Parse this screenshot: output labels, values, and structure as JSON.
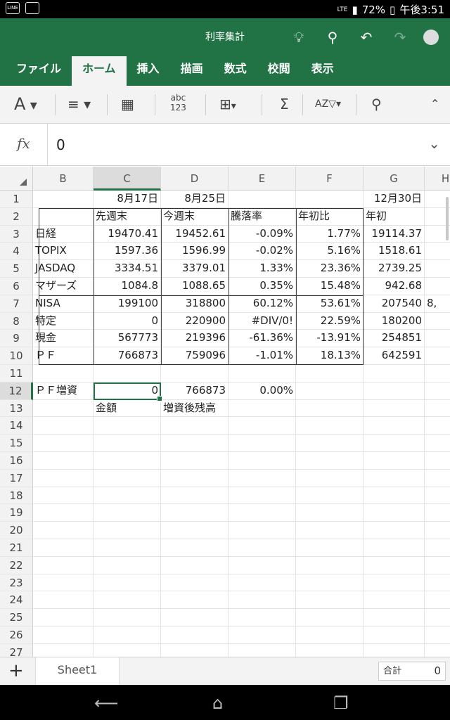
{
  "status": {
    "left_icons": [
      "LINE",
      "image-icon"
    ],
    "battery": "72%",
    "time": "午後3:51",
    "network": "LTE"
  },
  "title": "利率集計",
  "tabs": [
    "ファイル",
    "ホーム",
    "挿入",
    "描画",
    "数式",
    "校閲",
    "表示"
  ],
  "active_tab": "ホーム",
  "ribbon": {
    "font_a": "A",
    "align": "≡",
    "abc": "abc",
    "n123": "123",
    "sum": "Σ",
    "sort": "AZ"
  },
  "formula": {
    "fx": "fx",
    "value": "0"
  },
  "columns": [
    "B",
    "C",
    "D",
    "E",
    "F",
    "G",
    "H"
  ],
  "rows": [
    "1",
    "2",
    "3",
    "4",
    "5",
    "6",
    "7",
    "8",
    "9",
    "10",
    "11",
    "12",
    "13",
    "14",
    "15",
    "16",
    "17",
    "18",
    "19",
    "20",
    "21",
    "22",
    "23",
    "24",
    "25",
    "26",
    "27"
  ],
  "cells": {
    "1": {
      "C": "8月17日",
      "D": "8月25日",
      "G": "12月30日"
    },
    "2": {
      "C": "先週末",
      "D": "今週末",
      "E": "騰落率",
      "F": "年初比",
      "G": "年初"
    },
    "3": {
      "B": "日経",
      "C": "19470.41",
      "D": "19452.61",
      "E": "-0.09%",
      "F": "1.77%",
      "G": "19114.37"
    },
    "4": {
      "B": "TOPIX",
      "C": "1597.36",
      "D": "1596.99",
      "E": "-0.02%",
      "F": "5.16%",
      "G": "1518.61"
    },
    "5": {
      "B": "JASDAQ",
      "C": "3334.51",
      "D": "3379.01",
      "E": "1.33%",
      "F": "23.36%",
      "G": "2739.25"
    },
    "6": {
      "B": "マザーズ",
      "C": "1084.8",
      "D": "1088.65",
      "E": "0.35%",
      "F": "15.48%",
      "G": "942.68"
    },
    "7": {
      "B": "NISA",
      "C": "199100",
      "D": "318800",
      "E": "60.12%",
      "F": "53.61%",
      "G": "207540",
      "H": "8,"
    },
    "8": {
      "B": "特定",
      "C": "0",
      "D": "220900",
      "E": "#DIV/0!",
      "F": "22.59%",
      "G": "180200"
    },
    "9": {
      "B": "現金",
      "C": "567773",
      "D": "219396",
      "E": "-61.36%",
      "F": "-13.91%",
      "G": "254851"
    },
    "10": {
      "B": "ＰＦ",
      "C": "766873",
      "D": "759096",
      "E": "-1.01%",
      "F": "18.13%",
      "G": "642591"
    },
    "12": {
      "B": "ＰＦ増資",
      "C": "0",
      "D": "766873",
      "E": "0.00%"
    },
    "13": {
      "C": "金額",
      "D": "増資後残高"
    }
  },
  "sheet_tab": "Sheet1",
  "sum_label": "合計",
  "sum_value": "0",
  "colors": {
    "accent": "#217346"
  }
}
